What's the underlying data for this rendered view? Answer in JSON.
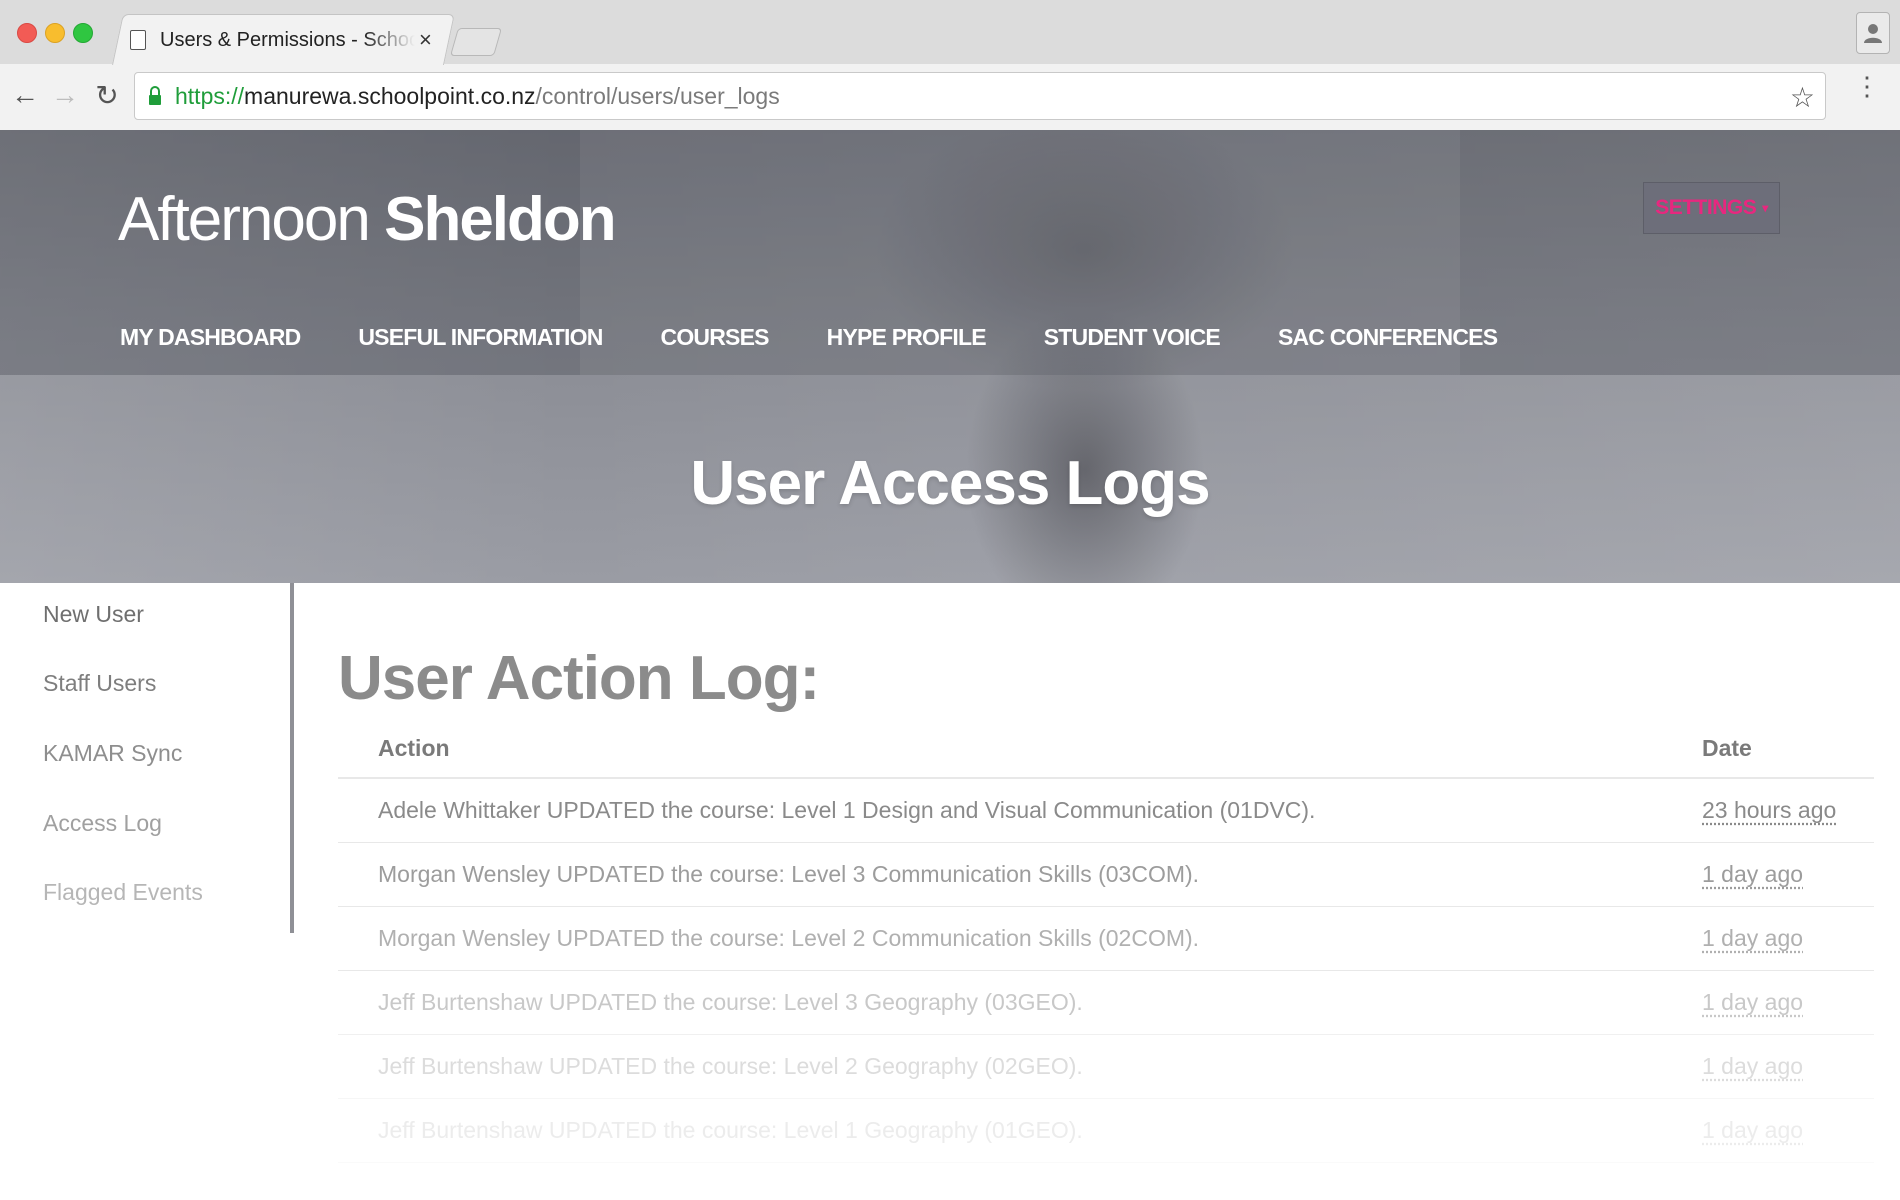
{
  "browser": {
    "tab_title": "Users & Permissions - SchoolPoint",
    "tab_close": "×",
    "url_scheme": "https://",
    "url_host": "manurewa.schoolpoint.co.nz",
    "url_path": "/control/users/user_logs",
    "star_icon": "☆",
    "menu_icon": "⋮",
    "back_icon": "←",
    "forward_icon": "→",
    "reload_icon": "↻"
  },
  "header": {
    "brand_light": "Afternoon",
    "brand_bold": "Sheldon",
    "settings_label": "SETTINGS",
    "settings_caret": "▾",
    "nav": [
      "MY DASHBOARD",
      "USEFUL INFORMATION",
      "COURSES",
      "HYPE PROFILE",
      "STUDENT VOICE",
      "SAC CONFERENCES"
    ],
    "page_title": "User Access Logs"
  },
  "sidebar": {
    "items": [
      "New User",
      "Staff Users",
      "KAMAR Sync",
      "Access Log",
      "Flagged Events"
    ]
  },
  "main": {
    "section_title": "User Action Log:",
    "columns": {
      "action": "Action",
      "date": "Date"
    },
    "rows": [
      {
        "action": "Adele Whittaker UPDATED the course: Level 1 Design and Visual Communication (01DVC).",
        "date": "23 hours ago"
      },
      {
        "action": "Morgan Wensley UPDATED the course: Level 3 Communication Skills (03COM).",
        "date": "1 day ago"
      },
      {
        "action": "Morgan Wensley UPDATED the course: Level 2 Communication Skills (02COM).",
        "date": "1 day ago"
      },
      {
        "action": "Jeff Burtenshaw UPDATED the course: Level 3 Geography (03GEO).",
        "date": "1 day ago"
      },
      {
        "action": "Jeff Burtenshaw UPDATED the course: Level 2 Geography (02GEO).",
        "date": "1 day ago"
      },
      {
        "action": "Jeff Burtenshaw UPDATED the course: Level 1 Geography (01GEO).",
        "date": "1 day ago"
      }
    ]
  },
  "colors": {
    "settings_text": "#e8277f",
    "secure_url": "#1f9d3a"
  }
}
